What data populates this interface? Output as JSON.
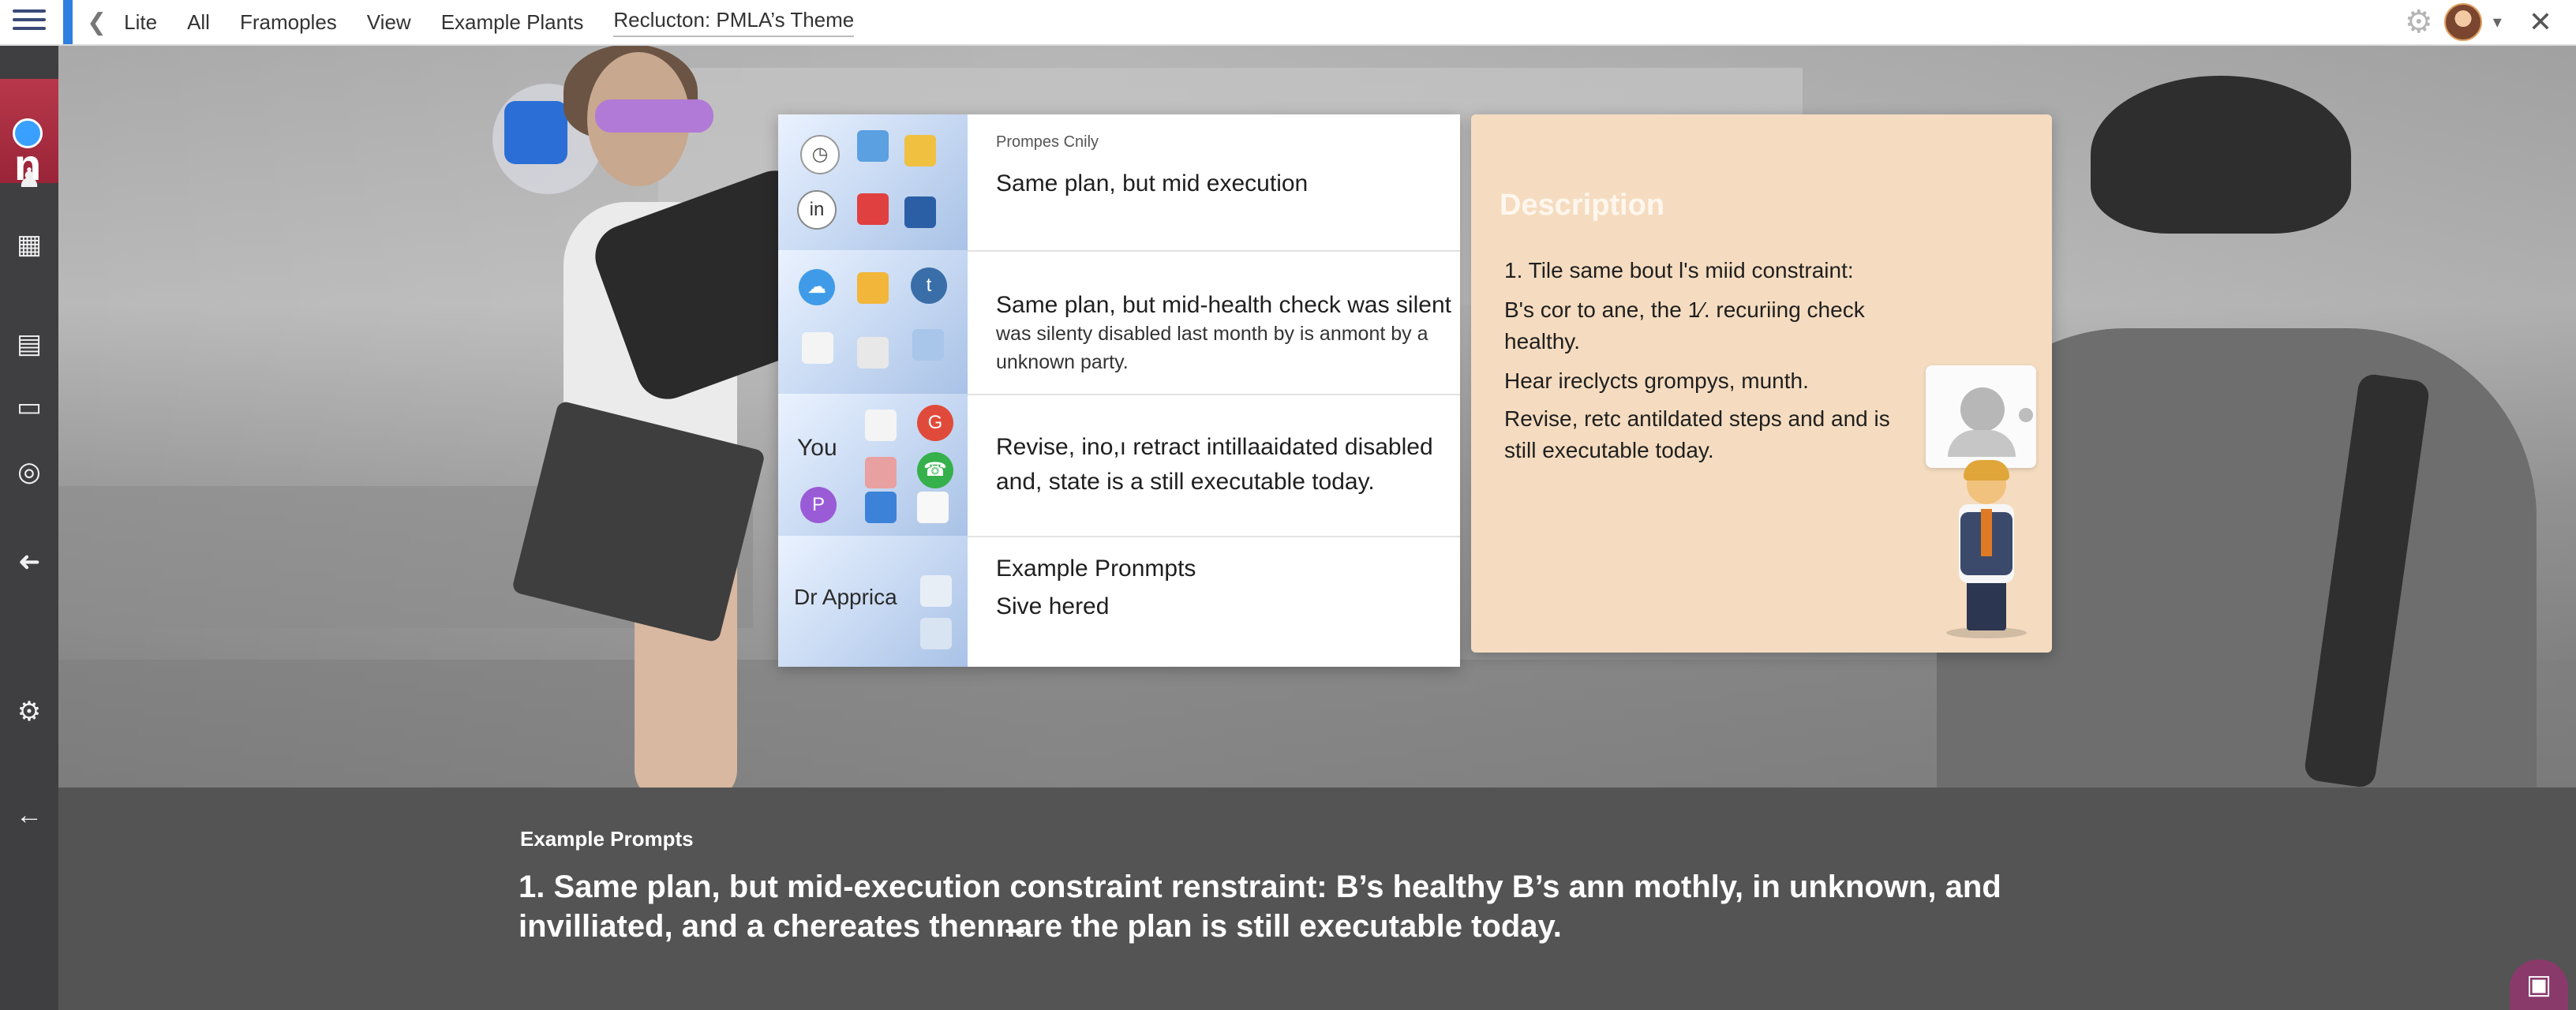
{
  "topbar": {
    "menu_icon": "hamburger-menu-icon",
    "back_icon": "back-arrow-icon",
    "tabs": [
      {
        "label": "Lite"
      },
      {
        "label": "All"
      },
      {
        "label": "Framoples"
      },
      {
        "label": "View"
      },
      {
        "label": "Example Plants"
      },
      {
        "label": "Reclucton: PMLA’s Theme"
      }
    ],
    "settings_icon": "gear-icon",
    "avatar_icon": "user-avatar",
    "caret_icon": "chevron-down-icon",
    "close_icon": "close-icon"
  },
  "sidebar": {
    "app_badge_letter": "n",
    "items": [
      {
        "icon": "person-icon",
        "glyph": "♟"
      },
      {
        "icon": "grid-icon",
        "glyph": "▦"
      },
      {
        "icon": "gallery-icon",
        "glyph": "▤"
      },
      {
        "icon": "monitor-icon",
        "glyph": "▭"
      },
      {
        "icon": "target-icon",
        "glyph": "◎"
      },
      {
        "icon": "share-arrow-icon",
        "glyph": "➜"
      },
      {
        "icon": "settings-gear-icon",
        "glyph": "⚙"
      },
      {
        "icon": "collapse-arrow-icon",
        "glyph": "←"
      }
    ]
  },
  "prompts": {
    "header_tag": "Prompes Cnily",
    "rows": [
      {
        "text": "Same plan, but mid execution"
      },
      {
        "text": "Same plan, but mid-health check was silent",
        "subtext": "was silenty disabled last month by is anmont by a unknown party."
      },
      {
        "text": "Revise, ino,ı retract intillaaidated disabled and,  state is a still executable today."
      },
      {
        "text": "Example Pronmpts",
        "subtext": "Sive hered"
      }
    ],
    "thumb_labels": {
      "row3": "You",
      "row4": "Dr Apprica"
    },
    "thumb_glyphs": [
      "in",
      "t",
      "P",
      "G"
    ]
  },
  "description": {
    "title": "Description",
    "lines": [
      "1. Tile same bout l's miid constraint:",
      "B's cor to ane, the 1⁄. recuriing check healthy.",
      "Hear ireclycts grompys, munth.",
      "Revise, retc antildated steps and and is still executable today."
    ]
  },
  "bottom": {
    "heading": "Example Prompts",
    "line1": "1. Same plan, but mid-execution constraint renstraint:  B’s healthy  B’s ann mothly, in unknown, and",
    "line2": "invilliated, and  a chereates thenn̶are the plan is still executable today."
  },
  "colors": {
    "accent": "#2f7fe0",
    "sidebar_bg": "#3f3f41",
    "app_badge": "#b8384a",
    "desc_card_bg": "#f5dcc0",
    "bottom_panel": "#545455"
  }
}
